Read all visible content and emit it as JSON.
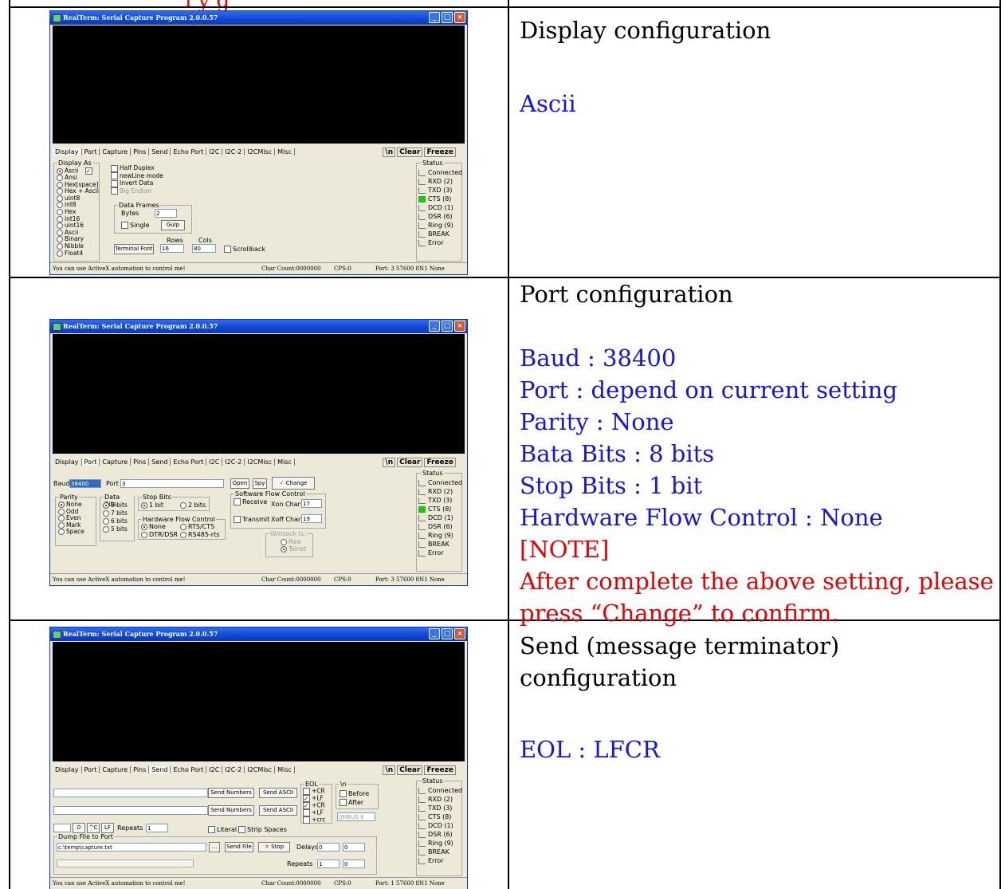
{
  "top_text": "ı y g",
  "rows": [
    {
      "heading": "Display configuration",
      "lines": [
        {
          "text": "Ascii",
          "color": "#1414e6"
        }
      ]
    },
    {
      "heading": "Port configuration",
      "lines": [
        {
          "text": "Baud : 38400",
          "color": "#1414e6"
        },
        {
          "text": "Port : depend on current setting",
          "color": "#1414e6"
        },
        {
          "text": "Parity : None",
          "color": "#1414e6"
        },
        {
          "text": "Bata Bits : 8 bits",
          "color": "#1414e6"
        },
        {
          "text": "Stop Bits : 1 bit",
          "color": "#1414e6"
        },
        {
          "text": "Hardware Flow Control : None",
          "color": "#1414e6"
        },
        {
          "text": "[NOTE]",
          "color": "#e60000"
        },
        {
          "text": "After complete the above setting, please",
          "color": "#e60000"
        },
        {
          "text": "press “Change” to confirm.",
          "color": "#e60000"
        }
      ]
    },
    {
      "heading": "Send (message terminator) configuration",
      "lines": [
        {
          "text": "EOL : LFCR",
          "color": "#1414e6"
        }
      ]
    }
  ],
  "realterm": {
    "title": "RealTerm: Serial Capture Program 2.0.0.57",
    "tabs": [
      "Display",
      "Port",
      "Capture",
      "Pins",
      "Send",
      "Echo Port",
      "I2C",
      "I2C-2",
      "I2CMisc",
      "Misc"
    ],
    "buttons": {
      "newline": "\\n",
      "clear": "Clear",
      "freeze": "Freeze"
    },
    "status_title": "Status",
    "status_leds": [
      "Connected",
      "RXD (2)",
      "TXD (3)",
      "CTS (8)",
      "DCD (1)",
      "DSR (6)",
      "Ring (9)",
      "BREAK",
      "Error"
    ],
    "statusbar": {
      "message": "You can use ActiveX automation to control me!",
      "char_count": "Char Count:0000000",
      "cps": "CPS:0",
      "port_status_1": "Port: 3 57600 8N1 None",
      "port_status_3": "Port: 1 57600 8N1 None"
    },
    "display_tab": {
      "display_as_title": "Display As",
      "display_as": [
        "Ascii",
        "Ansi",
        "Hex[space]",
        "Hex + Ascii",
        "uint8",
        "int8",
        "Hex",
        "int16",
        "uint16",
        "Ascii",
        "Binary",
        "Nibble",
        "Float4"
      ],
      "options": [
        "Half Duplex",
        "newLine mode",
        "Invert Data",
        "Big Endian"
      ],
      "data_frames_title": "Data Frames",
      "bytes_label": "Bytes",
      "bytes_value": "2",
      "single_label": "Single",
      "gulp_label": "Gulp",
      "rows_label": "Rows",
      "cols_label": "Cols",
      "terminal_font_label": "Terminal Font",
      "rows_value": "16",
      "cols_value": "80",
      "scrollback_label": "Scrollback"
    },
    "port_tab": {
      "baud_label": "Baud",
      "baud_value": "38400",
      "port_label": "Port",
      "port_value": "3",
      "open_label": "Open",
      "spy_label": "Spy",
      "change_label": "Change",
      "parity_title": "Parity",
      "parity": [
        "None",
        "Odd",
        "Even",
        "Mark",
        "Space"
      ],
      "data_bits_title": "Data Bits",
      "data_bits": [
        "8 bits",
        "7 bits",
        "6 bits",
        "5 bits"
      ],
      "stop_bits_title": "Stop Bits",
      "stop_bits": [
        "1 bit",
        "2 bits"
      ],
      "hw_flow_title": "Hardware Flow Control",
      "hw_flow": [
        "None",
        "RTS/CTS",
        "DTR/DSR",
        "RS485-rts"
      ],
      "sw_flow_title": "Software Flow Control",
      "receive_label": "Receive",
      "xon_label": "Xon Char:",
      "xon_value": "17",
      "transmit_label": "Transmit",
      "xoff_label": "Xoff Char:",
      "xoff_value": "19",
      "winsock_title": "Winsock is:",
      "winsock": [
        "Raw",
        "Telnet"
      ]
    },
    "send_tab": {
      "send_numbers": "Send Numbers",
      "send_ascii": "Send ASCII",
      "eol_title": "EOL",
      "eol": [
        "+CR",
        "+LF",
        "+CR",
        "+LF",
        "+crc"
      ],
      "nl_title": "\\n",
      "before_label": "Before",
      "after_label": "After",
      "smbus": "SMBUS 8",
      "zero_btn": "0",
      "c_btn": "^C",
      "lf_btn": "LF",
      "repeats_label": "Repeats",
      "repeats_value": "1",
      "literal_label": "Literal",
      "strip_spaces_label": "Strip Spaces",
      "dump_title": "Dump File to Port",
      "dump_path": "c:\\temp\\capture.txt",
      "browse": "...",
      "send_file": "Send File",
      "stop": "Stop",
      "delays_label": "Delays",
      "delay1": "0",
      "delay2": "0",
      "repeats2_value": "1",
      "repeats3_value": "0"
    }
  }
}
